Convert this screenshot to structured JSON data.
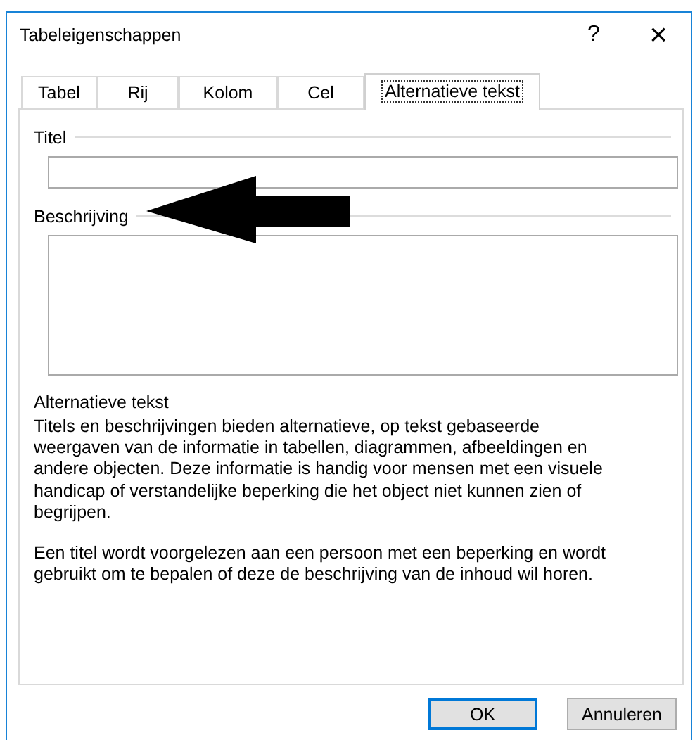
{
  "window": {
    "title": "Tabeleigenschappen",
    "help": "?",
    "close": "×"
  },
  "tabs": [
    {
      "label": "Tabel",
      "selected": false
    },
    {
      "label": "Rij",
      "selected": false
    },
    {
      "label": "Kolom",
      "selected": false
    },
    {
      "label": "Cel",
      "selected": false
    },
    {
      "label": "Alternatieve tekst",
      "selected": true
    }
  ],
  "title_field": {
    "label": "Titel"
  },
  "description_field": {
    "label": "Beschrijving"
  },
  "info": {
    "heading": "Alternatieve tekst",
    "paragraphs": [
      "Titels en beschrijvingen bieden alternatieve, op tekst gebaseerde weergaven van de informatie in tabellen, diagrammen, afbeeldingen en andere objecten. Deze informatie is handig voor mensen met een visuele handicap of verstandelijke beperking die het object niet kunnen zien of begrijpen.",
      "Een titel wordt voorgelezen aan een persoon met een beperking en wordt gebruikt om te bepalen of deze de beschrijving van de inhoud wil horen."
    ]
  },
  "buttons": [
    {
      "label": "OK",
      "default": true
    },
    {
      "label": "Annuleren",
      "default": false
    }
  ]
}
